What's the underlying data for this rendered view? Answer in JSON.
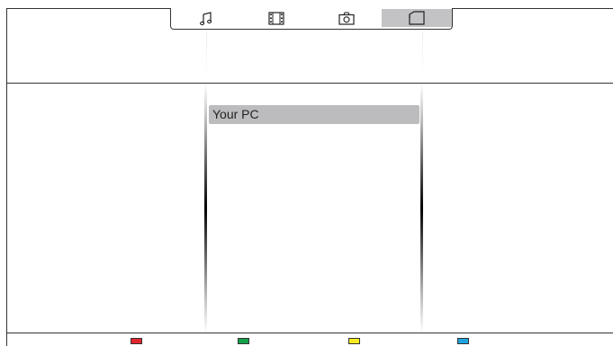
{
  "tabs": [
    {
      "id": "music",
      "icon": "music-note-icon",
      "active": false
    },
    {
      "id": "video",
      "icon": "film-strip-icon",
      "active": false
    },
    {
      "id": "photo",
      "icon": "camera-icon",
      "active": false
    },
    {
      "id": "folder",
      "icon": "folder-icon",
      "active": true
    }
  ],
  "list": {
    "items": [
      {
        "label": "Your PC",
        "selected": true
      }
    ]
  },
  "color_keys": [
    {
      "name": "red",
      "color": "#e1262d"
    },
    {
      "name": "green",
      "color": "#14a04a"
    },
    {
      "name": "yellow",
      "color": "#f7ec1f"
    },
    {
      "name": "blue",
      "color": "#1fa3dc"
    }
  ],
  "colors": {
    "active_tab": "#c3c3c5",
    "selected_item": "#bcbcbe"
  }
}
